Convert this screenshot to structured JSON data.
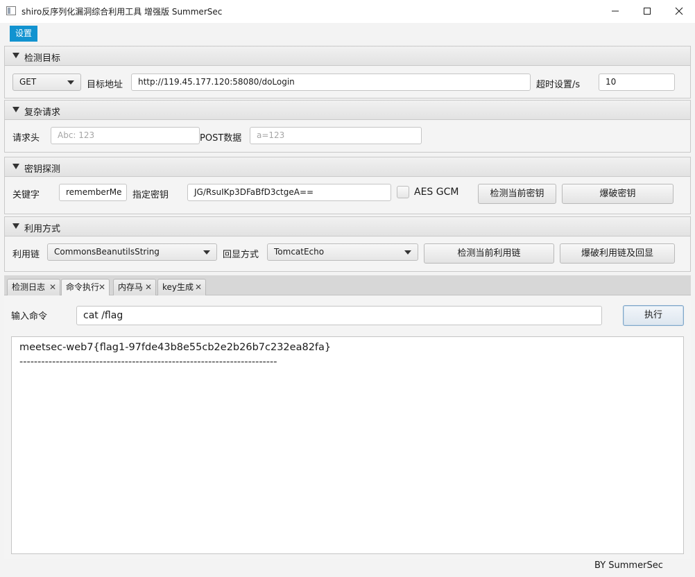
{
  "window": {
    "title": "shiro反序列化漏洞综合利用工具 增强版 SummerSec",
    "icon": "app-window-icon",
    "controls": [
      "minimize-icon",
      "maximize-icon",
      "close-icon"
    ]
  },
  "menu": {
    "settings_label": "设置"
  },
  "target_section": {
    "title": "检测目标",
    "method_value": "GET",
    "url_label": "目标地址",
    "url_value": "http://119.45.177.120:58080/doLogin",
    "timeout_label": "超时设置/s",
    "timeout_value": "10"
  },
  "complex_section": {
    "title": "复杂请求",
    "header_label": "请求头",
    "header_placeholder": "Abc: 123",
    "post_label": "POST数据",
    "post_placeholder": "a=123"
  },
  "key_section": {
    "title": "密钥探测",
    "keyword_label": "关键字",
    "keyword_value": "rememberMe",
    "key_label": "指定密钥",
    "key_value": "JG/RsuIKp3DFaBfD3ctgeA==",
    "aes_gcm_label": "AES GCM",
    "check_key_button": "检测当前密钥",
    "brute_key_button": "爆破密钥"
  },
  "exploit_section": {
    "title": "利用方式",
    "chain_label": "利用链",
    "chain_value": "CommonsBeanutilsString",
    "echo_label": "回显方式",
    "echo_value": "TomcatEcho",
    "check_chain_button": "检测当前利用链",
    "brute_chain_button": "爆破利用链及回显"
  },
  "tabs": [
    {
      "label": "检测日志",
      "active": false
    },
    {
      "label": "命令执行",
      "active": true
    },
    {
      "label": "内存马",
      "active": false
    },
    {
      "label": "key生成",
      "active": false
    }
  ],
  "tab_close_glyph": "✕",
  "command": {
    "label": "输入命令",
    "value": "cat /flag",
    "execute_button": "执行",
    "output_line1": "meetsec-web7{flag1-97fde43b8e55cb2e2b26b7c232ea82fa}",
    "output_line2": "-----------------------------------------------------------------------"
  },
  "footer": {
    "credit": "BY   SummerSec"
  }
}
